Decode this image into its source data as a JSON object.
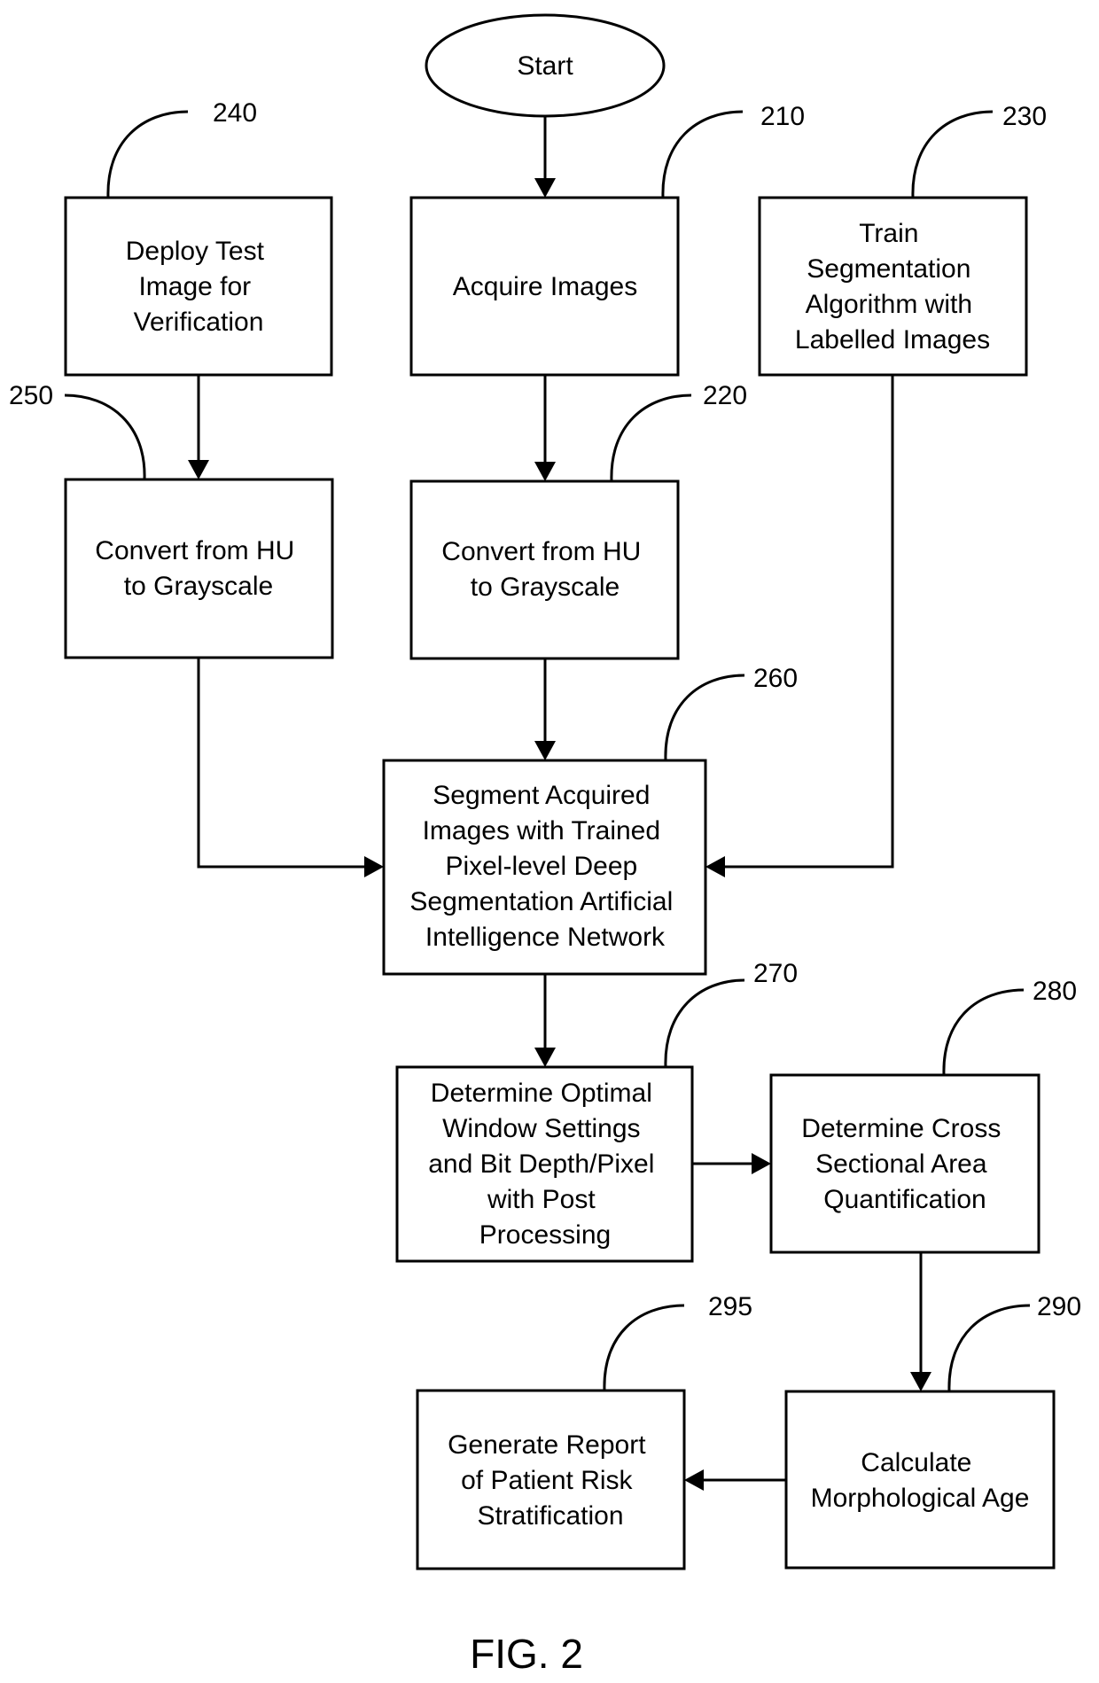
{
  "figure": {
    "caption": "FIG. 2",
    "colors": {
      "stroke": "#000000",
      "background": "#ffffff"
    }
  },
  "nodes": {
    "start": {
      "shape": "ellipse",
      "lines": [
        "Start"
      ]
    },
    "acquire": {
      "ref": "210",
      "lines": [
        "Acquire Images"
      ]
    },
    "convert_main": {
      "ref": "220",
      "lines": [
        "Convert from HU",
        "to Grayscale"
      ]
    },
    "train": {
      "ref": "230",
      "lines": [
        "Train",
        "Segmentation",
        "Algorithm with",
        "Labelled Images"
      ]
    },
    "deploy": {
      "ref": "240",
      "lines": [
        "Deploy Test",
        "Image for",
        "Verification"
      ]
    },
    "convert_test": {
      "ref": "250",
      "lines": [
        "Convert from HU",
        "to Grayscale"
      ]
    },
    "segment": {
      "ref": "260",
      "lines": [
        "Segment Acquired",
        "Images with Trained",
        "Pixel-level Deep",
        "Segmentation Artificial",
        "Intelligence Network"
      ]
    },
    "window": {
      "ref": "270",
      "lines": [
        "Determine Optimal",
        "Window Settings",
        "and Bit Depth/Pixel",
        "with Post",
        "Processing"
      ]
    },
    "cross": {
      "ref": "280",
      "lines": [
        "Determine Cross",
        "Sectional Area",
        "Quantification"
      ]
    },
    "morph": {
      "ref": "290",
      "lines": [
        "Calculate",
        "Morphological Age"
      ]
    },
    "report": {
      "ref": "295",
      "lines": [
        "Generate Report",
        "of Patient Risk",
        "Stratification"
      ]
    }
  },
  "edges": [
    {
      "from": "start",
      "to": "acquire"
    },
    {
      "from": "acquire",
      "to": "convert_main"
    },
    {
      "from": "deploy",
      "to": "convert_test"
    },
    {
      "from": "convert_main",
      "to": "segment"
    },
    {
      "from": "convert_test",
      "to": "segment"
    },
    {
      "from": "train",
      "to": "segment"
    },
    {
      "from": "segment",
      "to": "window"
    },
    {
      "from": "window",
      "to": "cross"
    },
    {
      "from": "cross",
      "to": "morph"
    },
    {
      "from": "morph",
      "to": "report"
    }
  ]
}
